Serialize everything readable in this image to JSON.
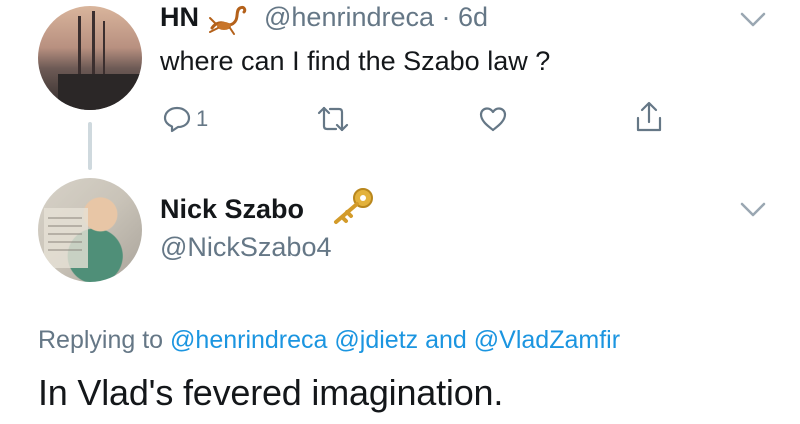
{
  "tweet1": {
    "name": "HN",
    "handle": "@henrindreca",
    "time": "· 6d",
    "text": "where can I find the Szabo law ?",
    "reply_count": "1",
    "icons": {
      "badge": "scorpion-icon",
      "reply": "reply-icon",
      "retweet": "retweet-icon",
      "like": "heart-icon",
      "share": "share-icon",
      "menu": "chevron-down-icon"
    }
  },
  "tweet2": {
    "name": "Nick Szabo",
    "handle": "@NickSzabo4",
    "replying_prefix": "Replying to",
    "mentions": [
      "@henrindreca",
      "@jdietz",
      "@VladZamfir"
    ],
    "mention_joiner": "and",
    "text": "In Vlad's fevered imagination.",
    "icons": {
      "badge": "key-icon",
      "menu": "chevron-down-icon"
    }
  },
  "colors": {
    "link": "#1b95e0",
    "secondary": "#657786",
    "primary": "#14171a",
    "line": "#cfd9de"
  }
}
